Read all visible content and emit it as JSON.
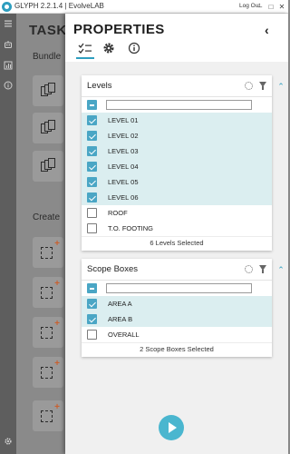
{
  "app": {
    "title": "GLYPH 2.2.1.4 | EvolveLAB",
    "logout": "Log Out",
    "win_min": "–",
    "win_max": "□",
    "win_close": "✕"
  },
  "tasks": {
    "title": "TASKS",
    "bundle_label": "Bundle",
    "create_label": "Create"
  },
  "panel": {
    "title": "PROPERTIES",
    "close_glyph": "‹",
    "tabs": [
      "checklist",
      "settings",
      "info"
    ]
  },
  "levels": {
    "title": "Levels",
    "search_placeholder": "",
    "items": [
      {
        "label": "LEVEL 01",
        "checked": true
      },
      {
        "label": "LEVEL 02",
        "checked": true
      },
      {
        "label": "LEVEL 03",
        "checked": true
      },
      {
        "label": "LEVEL 04",
        "checked": true
      },
      {
        "label": "LEVEL 05",
        "checked": true
      },
      {
        "label": "LEVEL 06",
        "checked": true
      },
      {
        "label": "ROOF",
        "checked": false
      },
      {
        "label": "T.O. FOOTING",
        "checked": false
      }
    ],
    "footer": "6 Levels Selected"
  },
  "scope_boxes": {
    "title": "Scope Boxes",
    "search_placeholder": "",
    "items": [
      {
        "label": "AREA A",
        "checked": true
      },
      {
        "label": "AREA B",
        "checked": true
      },
      {
        "label": "OVERALL",
        "checked": false
      }
    ],
    "footer": "2 Scope Boxes Selected"
  },
  "colors": {
    "accent": "#2e9ebf",
    "selected_row": "#dbeef0",
    "checkbox_on": "#4aa6c5",
    "play": "#4ab6cf"
  },
  "icons": {
    "rail": [
      "menu-icon",
      "robot-icon",
      "chart-icon",
      "info-icon",
      "gear-icon"
    ],
    "card": [
      "refresh-icon",
      "filter-icon",
      "collapse-icon"
    ]
  }
}
